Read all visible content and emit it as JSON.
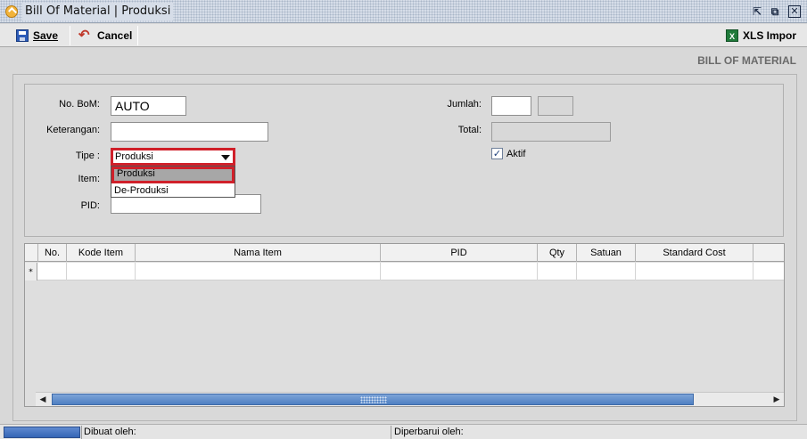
{
  "window": {
    "title": "Bill Of Material | Produksi",
    "controls": [
      "restore-icon",
      "maximize-icon",
      "close-icon"
    ]
  },
  "toolbar": {
    "save_label": "Save",
    "cancel_label": "Cancel",
    "xls_label": "XLS Impor",
    "xls_icon_text": "X"
  },
  "form": {
    "header": "BILL OF MATERIAL",
    "no_bom_label": "No. BoM:",
    "no_bom_value": "AUTO",
    "keterangan_label": "Keterangan:",
    "keterangan_value": "",
    "tipe_label": "Tipe :",
    "tipe_value": "Produksi",
    "tipe_options": [
      "Produksi",
      "De-Produksi"
    ],
    "item_label": "Item:",
    "pid_label": "PID:",
    "jumlah_label": "Jumlah:",
    "total_label": "Total:",
    "aktif_label": "Aktif",
    "aktif_checked": true
  },
  "grid": {
    "columns": [
      "No.",
      "Kode Item",
      "Nama Item",
      "PID",
      "Qty",
      "Satuan",
      "Standard Cost"
    ],
    "new_row_marker": "*"
  },
  "status": {
    "created_by_label": "Dibuat oleh:",
    "updated_by_label": "Diperbarui oleh:"
  }
}
